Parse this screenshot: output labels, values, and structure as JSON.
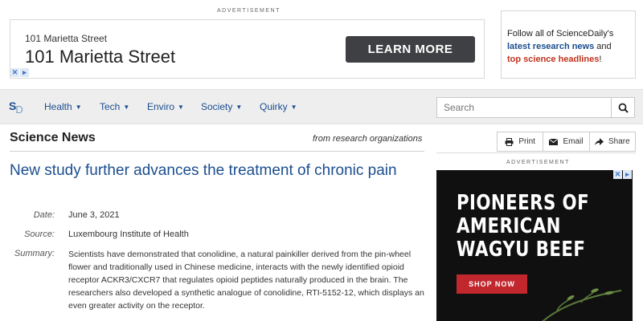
{
  "top_ad": {
    "label": "ADVERTISEMENT",
    "small_text": "101 Marietta Street",
    "big_text": "101 Marietta Street",
    "cta": "LEARN MORE"
  },
  "follow_box": {
    "line1": "Follow all of ScienceDaily's",
    "link1": "latest research news",
    "and": " and",
    "link2": "top science headlines",
    "end": "!"
  },
  "nav": {
    "logo_s": "S",
    "logo_d": "D",
    "items": [
      {
        "label": "Health"
      },
      {
        "label": "Tech"
      },
      {
        "label": "Enviro"
      },
      {
        "label": "Society"
      },
      {
        "label": "Quirky"
      }
    ],
    "search_placeholder": "Search"
  },
  "main": {
    "section_title": "Science News",
    "from": "from research organizations",
    "headline": "New study further advances the treatment of chronic pain",
    "date_label": "Date:",
    "date": "June 3, 2021",
    "source_label": "Source:",
    "source": "Luxembourg Institute of Health",
    "summary_label": "Summary:",
    "summary": "Scientists have demonstrated that conolidine, a natural painkiller derived from the pin-wheel flower and traditionally used in Chinese medicine, interacts with the newly identified opioid receptor ACKR3/CXCR7 that regulates opioid peptides naturally produced in the brain. The researchers also developed a synthetic analogue of conolidine, RTI-5152-12, which displays an even greater activity on the receptor."
  },
  "share": {
    "print": "Print",
    "email": "Email",
    "share": "Share"
  },
  "right_ad": {
    "label": "ADVERTISEMENT",
    "headline_lines": [
      "PIONEERS OF",
      "AMERICAN",
      "WAGYU BEEF"
    ],
    "cta": "SHOP NOW"
  },
  "colors": {
    "link_blue": "#1b4e8f",
    "accent_red": "#c0341d",
    "ad_dark": "#101010",
    "cta_red": "#c1272d"
  }
}
